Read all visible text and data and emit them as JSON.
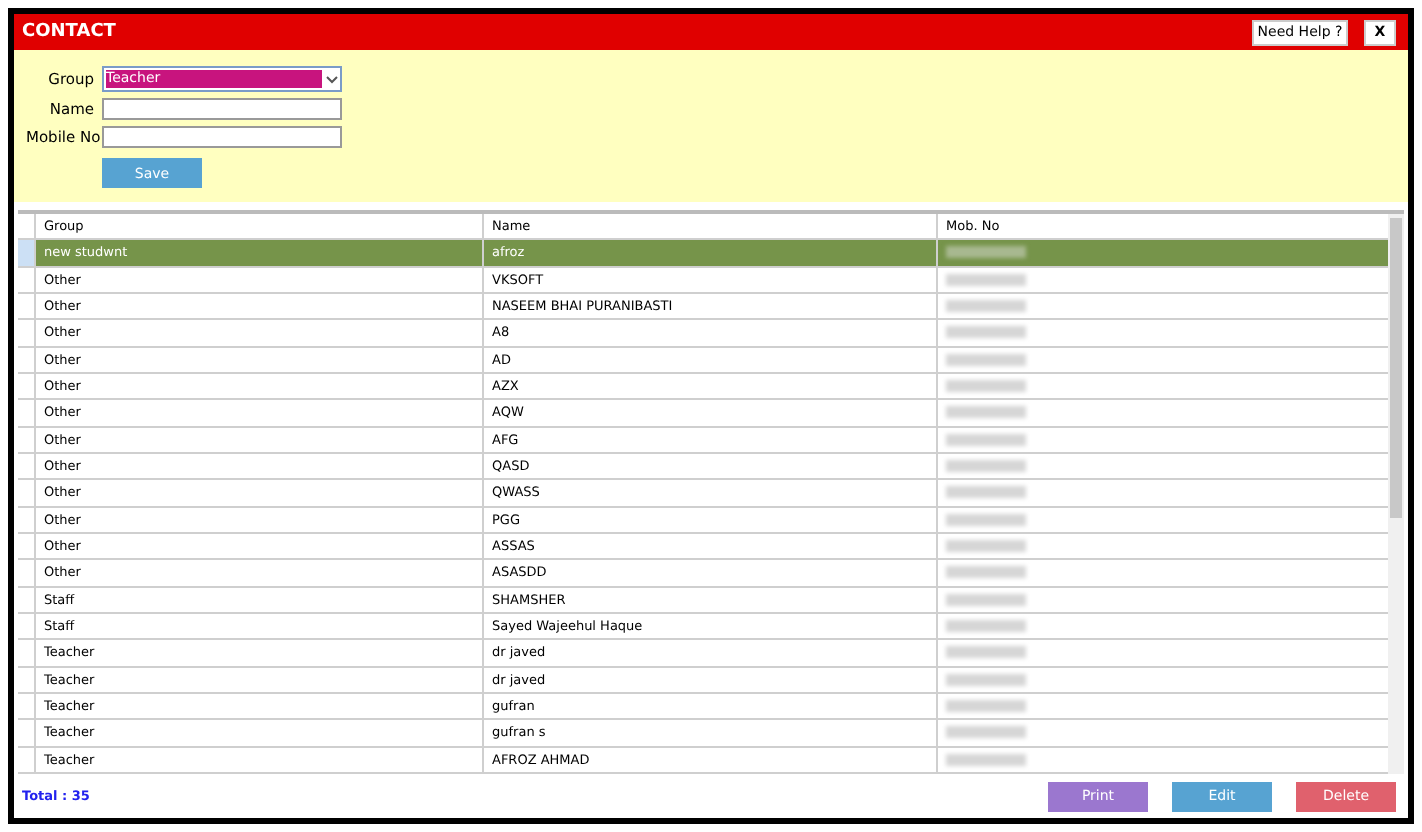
{
  "window": {
    "title": "CONTACT",
    "help_button": "Need Help ?",
    "close_button": "X"
  },
  "form": {
    "fields": [
      {
        "kind": "select",
        "label": "Group",
        "value": "Teacher"
      },
      {
        "kind": "text",
        "label": "Name"
      },
      {
        "kind": "text",
        "label": "Mobile No"
      }
    ],
    "save_button": "Save"
  },
  "table": {
    "columns": [
      "Group",
      "Name",
      "Mob. No"
    ],
    "rows": [
      {
        "group": "new studwnt",
        "name": "afroz",
        "selected": true
      },
      {
        "group": "Other",
        "name": "VKSOFT",
        "selected": false
      },
      {
        "group": "Other",
        "name": "NASEEM BHAI PURANIBASTI",
        "selected": false
      },
      {
        "group": "Other",
        "name": "A8",
        "selected": false
      },
      {
        "group": "Other",
        "name": "AD",
        "selected": false
      },
      {
        "group": "Other",
        "name": "AZX",
        "selected": false
      },
      {
        "group": "Other",
        "name": "AQW",
        "selected": false
      },
      {
        "group": "Other",
        "name": "AFG",
        "selected": false
      },
      {
        "group": "Other",
        "name": "QASD",
        "selected": false
      },
      {
        "group": "Other",
        "name": "QWASS",
        "selected": false
      },
      {
        "group": "Other",
        "name": "PGG",
        "selected": false
      },
      {
        "group": "Other",
        "name": "ASSAS",
        "selected": false
      },
      {
        "group": "Other",
        "name": "ASASDD",
        "selected": false
      },
      {
        "group": "Staff",
        "name": "SHAMSHER",
        "selected": false
      },
      {
        "group": "Staff",
        "name": "Sayed Wajeehul Haque",
        "selected": false
      },
      {
        "group": "Teacher",
        "name": "dr javed",
        "selected": false
      },
      {
        "group": "Teacher",
        "name": "dr javed",
        "selected": false
      },
      {
        "group": "Teacher",
        "name": "gufran",
        "selected": false
      },
      {
        "group": "Teacher",
        "name": "gufran s",
        "selected": false
      },
      {
        "group": "Teacher",
        "name": "AFROZ AHMAD",
        "selected": false
      }
    ]
  },
  "footer": {
    "total": "Total : 35",
    "buttons": [
      {
        "kind": "print",
        "label": "Print"
      },
      {
        "kind": "edit",
        "label": "Edit"
      },
      {
        "kind": "delete",
        "label": "Delete"
      }
    ]
  }
}
